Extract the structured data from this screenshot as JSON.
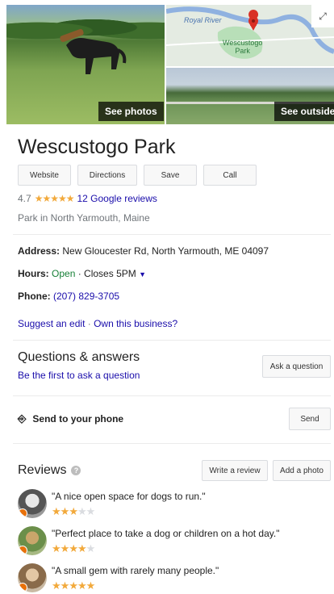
{
  "photos": {
    "see_photos_label": "See photos",
    "see_outside_label": "See outside",
    "expand_icon": "expand-icon",
    "map": {
      "river_label": "Royal River",
      "park_label_1": "Wescustogo",
      "park_label_2": "Park"
    }
  },
  "place": {
    "title": "Wescustogo Park",
    "rating": "4.7",
    "reviews_link": "12 Google reviews",
    "category": "Park in North Yarmouth, Maine"
  },
  "actions": {
    "website": "Website",
    "directions": "Directions",
    "save": "Save",
    "call": "Call"
  },
  "details": {
    "address_label": "Address:",
    "address_value": "New Gloucester Rd, North Yarmouth, ME 04097",
    "hours_label": "Hours:",
    "hours_status": "Open",
    "hours_detail": "· Closes 5PM",
    "phone_label": "Phone:",
    "phone_value": "(207) 829-3705",
    "suggest_edit": "Suggest an edit",
    "separator": "·",
    "own_business": "Own this business?"
  },
  "qa": {
    "title": "Questions & answers",
    "first_link": "Be the first to ask a question",
    "ask_button": "Ask a question"
  },
  "send": {
    "label": "Send to your phone",
    "button": "Send"
  },
  "reviews": {
    "title": "Reviews",
    "write_button": "Write a review",
    "add_photo_button": "Add a photo",
    "items": [
      {
        "text": "\"A nice open space for dogs to run.\"",
        "stars": 3
      },
      {
        "text": "\"Perfect place to take a dog or children on a hot day.\"",
        "stars": 4
      },
      {
        "text": "\"A small gem with rarely many people.\"",
        "stars": 5
      }
    ]
  },
  "colors": {
    "link": "#1a0dab",
    "star": "#f2a93b",
    "open": "#188038",
    "badge": "#e8710a"
  }
}
